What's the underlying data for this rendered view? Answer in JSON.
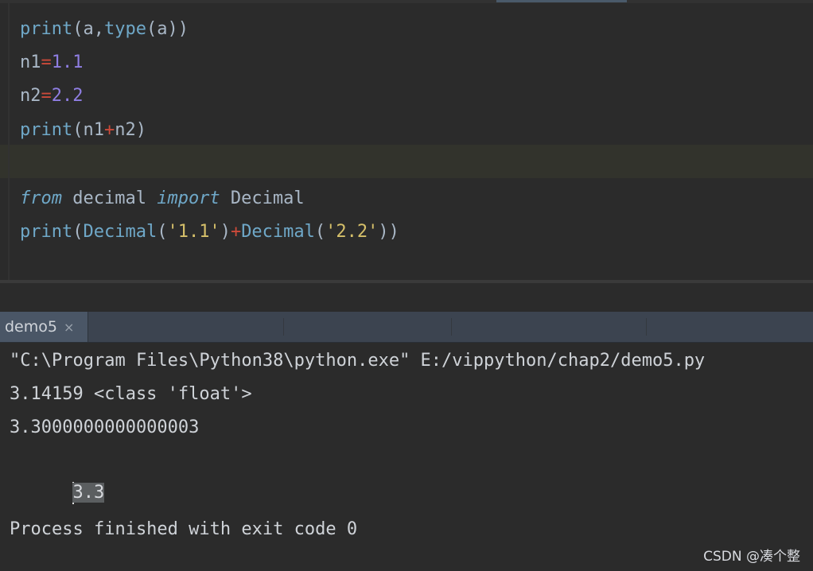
{
  "editor": {
    "lines": [
      {
        "segments": [
          {
            "text": "print",
            "cls": "kw-builtin"
          },
          {
            "text": "(a,",
            "cls": "paren"
          },
          {
            "text": "type",
            "cls": "kw-builtin"
          },
          {
            "text": "(a))",
            "cls": "paren"
          }
        ]
      },
      {
        "segments": [
          {
            "text": "n1",
            "cls": ""
          },
          {
            "text": "=",
            "cls": "op"
          },
          {
            "text": "1.1",
            "cls": "num"
          }
        ]
      },
      {
        "segments": [
          {
            "text": "n2",
            "cls": ""
          },
          {
            "text": "=",
            "cls": "op"
          },
          {
            "text": "2.2",
            "cls": "num"
          }
        ]
      },
      {
        "segments": [
          {
            "text": "print",
            "cls": "kw-builtin"
          },
          {
            "text": "(n1",
            "cls": "paren"
          },
          {
            "text": "+",
            "cls": "op"
          },
          {
            "text": "n2)",
            "cls": "paren"
          }
        ]
      },
      {
        "segments": []
      },
      {
        "segments": [
          {
            "text": "from",
            "cls": "kw-import"
          },
          {
            "text": " decimal ",
            "cls": ""
          },
          {
            "text": "import",
            "cls": "kw-import"
          },
          {
            "text": " Decimal",
            "cls": ""
          }
        ]
      },
      {
        "segments": [
          {
            "text": "print",
            "cls": "kw-builtin"
          },
          {
            "text": "(",
            "cls": "paren"
          },
          {
            "text": "Decimal",
            "cls": "kw-class"
          },
          {
            "text": "(",
            "cls": "paren"
          },
          {
            "text": "'1.1'",
            "cls": "str"
          },
          {
            "text": ")",
            "cls": "paren"
          },
          {
            "text": "+",
            "cls": "op"
          },
          {
            "text": "Decimal",
            "cls": "kw-class"
          },
          {
            "text": "(",
            "cls": "paren"
          },
          {
            "text": "'2.2'",
            "cls": "str"
          },
          {
            "text": "))",
            "cls": "paren"
          }
        ]
      }
    ]
  },
  "run_tab": {
    "label": "demo5",
    "close_glyph": "×"
  },
  "console": {
    "command": "\"C:\\Program Files\\Python38\\python.exe\" E:/vippython/chap2/demo5.py",
    "output_1": "3.14159 <class 'float'>",
    "output_2": "3.3000000000000003",
    "output_3": "3.3",
    "blank": "",
    "exit_message": "Process finished with exit code 0"
  },
  "watermark": "CSDN @凑个整",
  "colors": {
    "background": "#2b2b2b",
    "builtin": "#6fa8c8",
    "number": "#8f7ee3",
    "operator": "#cc4a3a",
    "string": "#d6c06a",
    "tab_bar": "#3c4450"
  }
}
